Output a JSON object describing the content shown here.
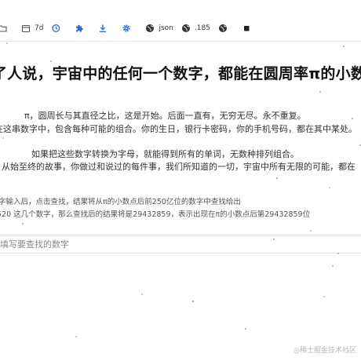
{
  "toolbar": {
    "items": [
      {
        "label": "",
        "icon": "folder-icon"
      },
      {
        "label": "7d",
        "icon": "calendar-icon"
      },
      {
        "label": "",
        "icon": "history-icon"
      },
      {
        "label": "",
        "icon": "extension-icon"
      },
      {
        "label": "",
        "icon": "download-icon"
      },
      {
        "label": "",
        "icon": "gear-icon"
      },
      {
        "label": "json",
        "icon": "globe-icon"
      },
      {
        "label": ".185",
        "icon": "globe-icon"
      },
      {
        "label": "",
        "icon": "globe-icon"
      },
      {
        "label": "",
        "icon": "stop-icon"
      }
    ],
    "icon_color": "#2a6fdb"
  },
  "page": {
    "headline": "了人说，宇宙中的任何一个数字，都能在圆周率π的小数",
    "paragraph": [
      "π，圆周长与其直径之比，这是开始。后面一直有，无穷无尽。永不重复。",
      "在这串数字中，包含每种可能的组合。你的生日，银行卡密码，你的手机号码，都在其中某处。",
      "如果把这些数字转换为字母，就能得到所有的单词，无数种排列组合。",
      "从始至终的故事，你做过和说过的每件事，我们所知道的一切，宇宙中所有无限的可能，都在"
    ],
    "hint": [
      "字输入后，点击查找，结果将从π的小数点后前250亿位的数字中查找给出",
      "520 这几个数字，那么查找后的结果将是29432859，表示出现在π的小数点后第29432859位"
    ],
    "search_placeholder": "填写要查找的数字"
  },
  "watermark": "◎稀土掘金技术社区"
}
